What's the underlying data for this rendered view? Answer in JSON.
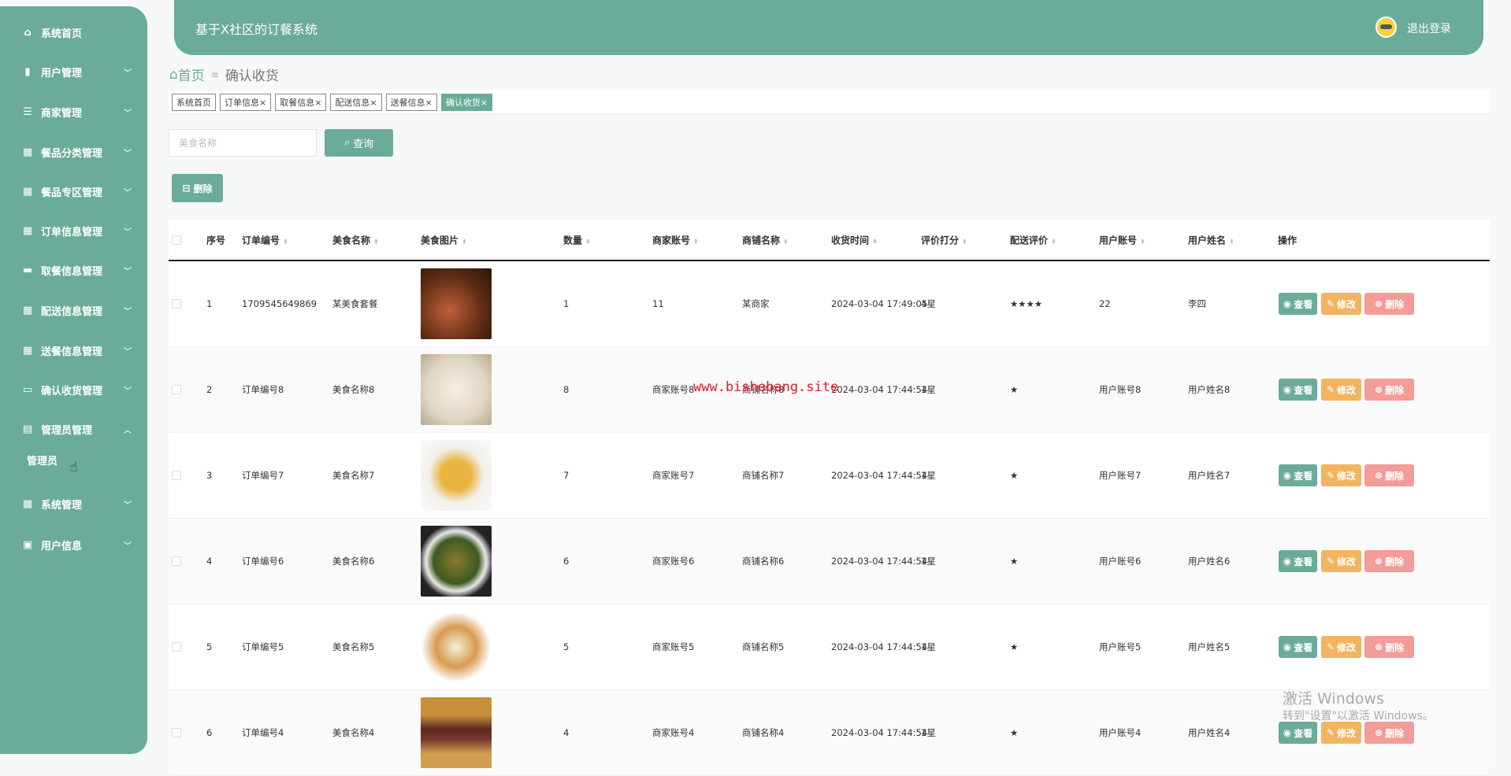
{
  "sidebar": {
    "items": [
      {
        "label": "系统首页",
        "icon": "home-icon",
        "glyph": "⌂",
        "chev": ""
      },
      {
        "label": "用户管理",
        "icon": "clipboard-icon",
        "glyph": "▮",
        "chev": "﹀"
      },
      {
        "label": "商家管理",
        "icon": "sliders-icon",
        "glyph": "☰",
        "chev": "﹀"
      },
      {
        "label": "餐品分类管理",
        "icon": "grid-icon",
        "glyph": "▦",
        "chev": "﹀"
      },
      {
        "label": "餐品专区管理",
        "icon": "grid-icon",
        "glyph": "▦",
        "chev": "﹀"
      },
      {
        "label": "订单信息管理",
        "icon": "grid-icon",
        "glyph": "▦",
        "chev": "﹀"
      },
      {
        "label": "取餐信息管理",
        "icon": "document-icon",
        "glyph": "▬",
        "chev": "﹀"
      },
      {
        "label": "配送信息管理",
        "icon": "grid-icon",
        "glyph": "▦",
        "chev": "﹀"
      },
      {
        "label": "送餐信息管理",
        "icon": "grid-icon",
        "glyph": "▦",
        "chev": "﹀"
      },
      {
        "label": "确认收货管理",
        "icon": "box-icon",
        "glyph": "▭",
        "chev": "﹀"
      },
      {
        "label": "管理员管理",
        "icon": "table-icon",
        "glyph": "▤",
        "chev": "︿"
      }
    ],
    "sub_item": "管理员",
    "bottom_items": [
      {
        "label": "系统管理",
        "icon": "grid-icon",
        "glyph": "▦",
        "chev": "﹀"
      },
      {
        "label": "用户信息",
        "icon": "calendar-icon",
        "glyph": "▣",
        "chev": "﹀"
      }
    ]
  },
  "header": {
    "title": "基于X社区的订餐系统",
    "logout": "退出登录"
  },
  "breadcrumb": {
    "home": "首页",
    "current": "确认收货"
  },
  "tags": [
    {
      "label": "系统首页",
      "close": ""
    },
    {
      "label": "订单信息",
      "close": "×"
    },
    {
      "label": "取餐信息",
      "close": "×"
    },
    {
      "label": "配送信息",
      "close": "×"
    },
    {
      "label": "送餐信息",
      "close": "×"
    },
    {
      "label": "确认收货",
      "close": "×",
      "active": true
    }
  ],
  "search": {
    "placeholder": "美食名称",
    "button": "查询"
  },
  "delete_button": "删除",
  "table": {
    "columns": [
      "序号",
      "订单编号",
      "美食名称",
      "美食图片",
      "数量",
      "商家账号",
      "商铺名称",
      "收货时间",
      "评价打分",
      "配送评价",
      "用户账号",
      "用户姓名",
      "操作"
    ],
    "sortable": [
      false,
      true,
      true,
      true,
      true,
      true,
      true,
      true,
      true,
      true,
      true,
      true,
      false
    ],
    "actions": {
      "view": "查看",
      "edit": "修改",
      "delete": "删除"
    },
    "rows": [
      [
        "1",
        "1709545649869",
        "某美食套餐",
        "",
        "1",
        "11",
        "某商家",
        "2024-03-04 17:49:05",
        "4星",
        "★★★★",
        "22",
        "李四"
      ],
      [
        "2",
        "订单编号8",
        "美食名称8",
        "",
        "8",
        "商家账号8",
        "商铺名称8",
        "2024-03-04 17:44:54",
        "1星",
        "★",
        "用户账号8",
        "用户姓名8"
      ],
      [
        "3",
        "订单编号7",
        "美食名称7",
        "",
        "7",
        "商家账号7",
        "商铺名称7",
        "2024-03-04 17:44:54",
        "1星",
        "★",
        "用户账号7",
        "用户姓名7"
      ],
      [
        "4",
        "订单编号6",
        "美食名称6",
        "",
        "6",
        "商家账号6",
        "商铺名称6",
        "2024-03-04 17:44:54",
        "1星",
        "★",
        "用户账号6",
        "用户姓名6"
      ],
      [
        "5",
        "订单编号5",
        "美食名称5",
        "",
        "5",
        "商家账号5",
        "商铺名称5",
        "2024-03-04 17:44:54",
        "1星",
        "★",
        "用户账号5",
        "用户姓名5"
      ],
      [
        "6",
        "订单编号4",
        "美食名称4",
        "",
        "4",
        "商家账号4",
        "商铺名称4",
        "2024-03-04 17:44:54",
        "1星",
        "★",
        "用户账号4",
        "用户姓名4"
      ]
    ]
  },
  "overlay": {
    "watermark": "www.bishebang.site",
    "activate_title": "激活 Windows",
    "activate_sub": "转到\"设置\"以激活 Windows。"
  },
  "colors": {
    "primary": "#6aab99",
    "edit": "#f2b460",
    "delete": "#f39c98"
  }
}
